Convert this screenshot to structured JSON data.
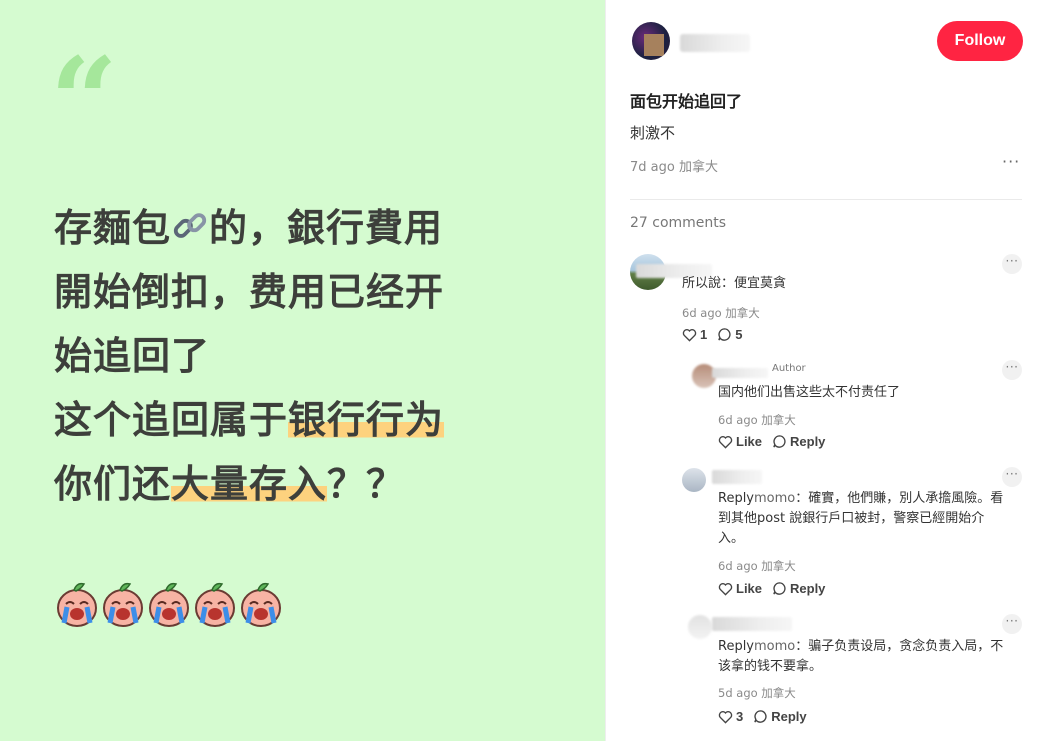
{
  "image_post": {
    "quote_mark": "“",
    "lines": [
      {
        "before": "存麵包",
        "icon": "link-icon",
        "after": "的，銀行費用"
      },
      {
        "text": "開始倒扣，费用已经开"
      },
      {
        "text": "始追回了"
      },
      {
        "before": "这个追回属于",
        "highlight": "银行行为"
      },
      {
        "before": "你们还",
        "highlight": "大量存入",
        "after": "？？"
      }
    ],
    "emoji_icon": "crying-peach-icon",
    "emoji_count": 5
  },
  "post": {
    "follow_label": "Follow",
    "title": "面包开始追回了",
    "body": "刺激不",
    "meta": "7d ago 加拿大",
    "more": "···",
    "comments_count": "27 comments"
  },
  "comments": [
    {
      "text": "所以說：便宜莫貪",
      "meta": "6d ago 加拿大",
      "likes": "1",
      "replies": "5",
      "more": "···"
    },
    {
      "author_tag": "Author",
      "text": "国内他们出售这些太不付责任了",
      "meta": "6d ago 加拿大",
      "like_label": "Like",
      "reply_label": "Reply",
      "more": "···"
    },
    {
      "reply_prefix": "Reply",
      "reply_to": "momo",
      "text_lines": [
        "：確實，他們賺，別人承擔風險。看",
        "到其他post 說銀行戶口被封，警察已經開始介",
        "入。"
      ],
      "meta": "6d ago 加拿大",
      "like_label": "Like",
      "reply_label": "Reply",
      "more": "···"
    },
    {
      "reply_prefix": "Reply",
      "reply_to": "momo",
      "text_lines": [
        "：骗子负责设局，贪念负责入局，不",
        "该拿的钱不要拿。"
      ],
      "meta": "5d ago 加拿大",
      "likes": "3",
      "reply_label": "Reply",
      "more": "···"
    }
  ],
  "colors": {
    "left_bg": "#d5fbd0",
    "quote": "#a5e79b",
    "highlight": "#fdd27e",
    "follow": "#ff2442"
  }
}
